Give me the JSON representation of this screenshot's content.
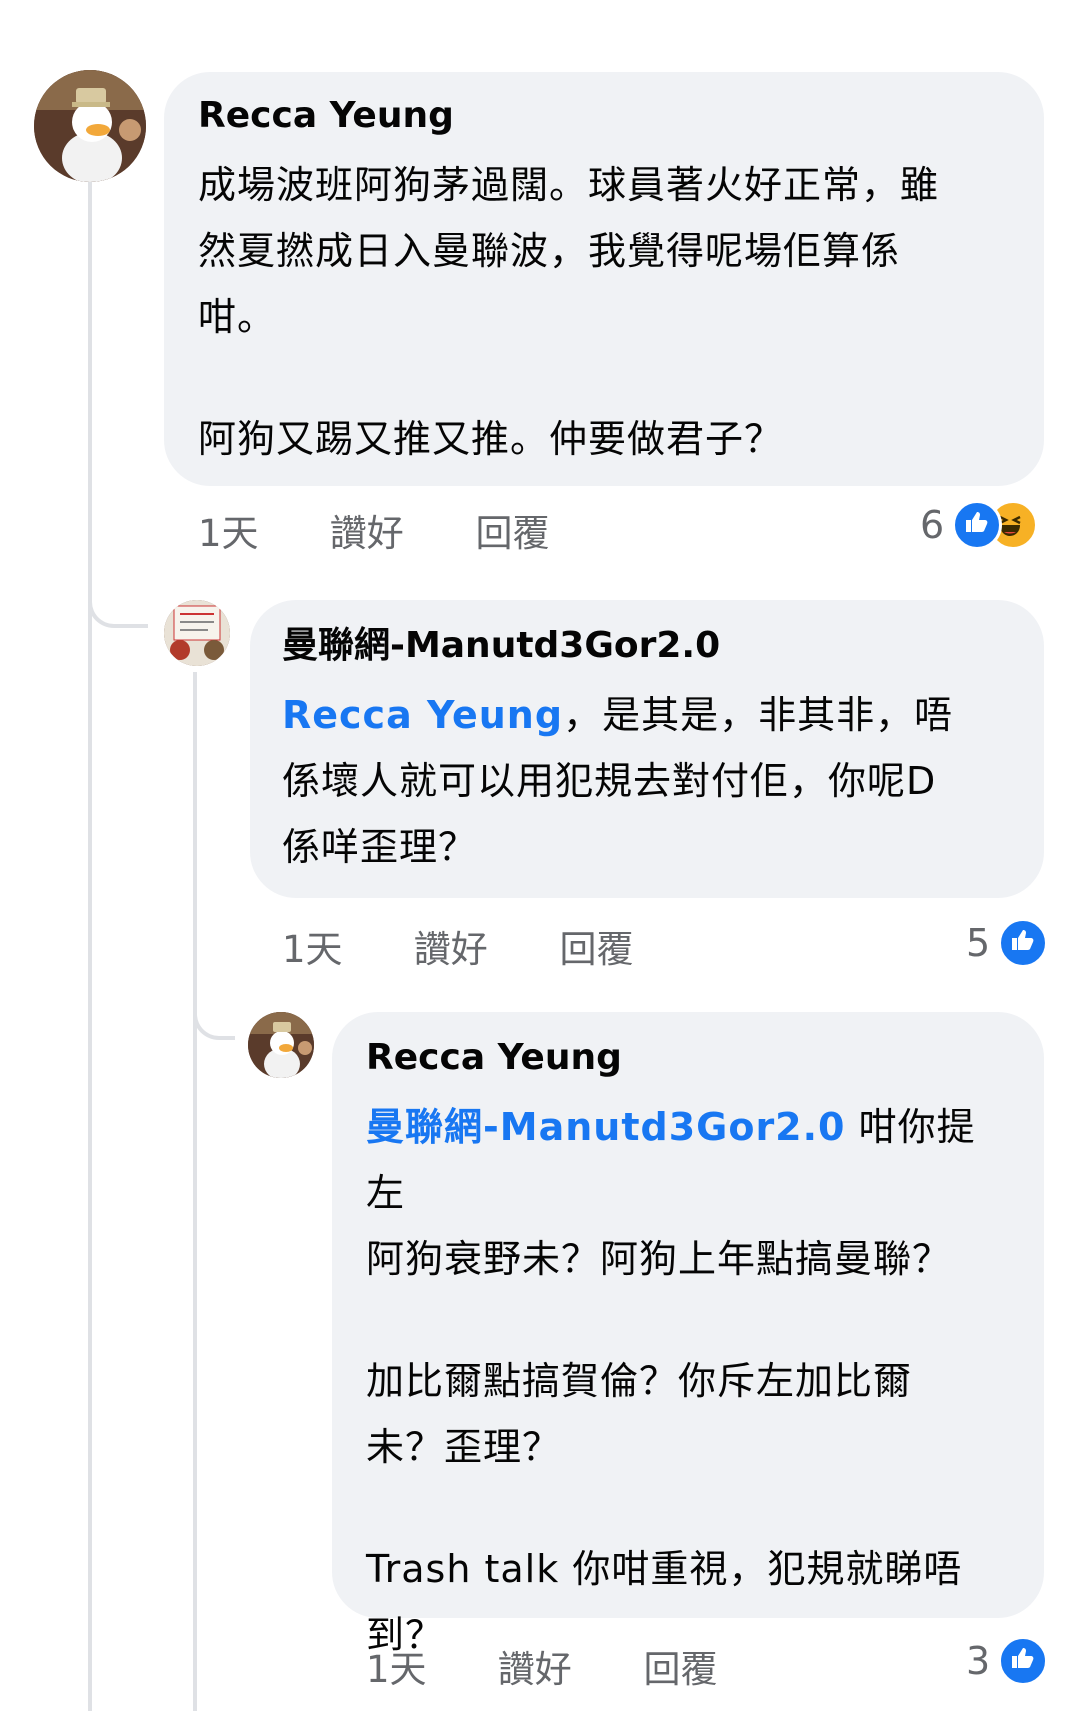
{
  "comments": [
    {
      "author": "Recca Yeung",
      "lines": [
        "成場波班阿狗茅過闊。球員著火好正常，雖",
        "然夏撚成日入曼聯波，我覺得呢場佢算係",
        "咁。"
      ],
      "lines2": [
        "阿狗又踢又推又推。仲要做君子？"
      ],
      "time": "1天",
      "like_label": "讚好",
      "reply_label": "回覆",
      "reaction_count": "6",
      "reactions": [
        "like-icon",
        "haha-icon"
      ]
    },
    {
      "author": "曼聯網-Manutd3Gor2.0",
      "mention": "Recca Yeung",
      "line1_rest": "，是其是，非其非，唔",
      "lines": [
        "係壞人就可以用犯規去對付佢，你呢D",
        "係咩歪理？"
      ],
      "time": "1天",
      "like_label": "讚好",
      "reply_label": "回覆",
      "reaction_count": "5",
      "reactions": [
        "like-icon"
      ]
    },
    {
      "author": "Recca Yeung",
      "mention": "曼聯網-Manutd3Gor2.0",
      "line1_rest": " 咁你提左",
      "lines": [
        "阿狗衰野未？阿狗上年點搞曼聯？"
      ],
      "lines2": [
        "加比爾點搞賀倫？你斥左加比爾",
        "未？歪理？"
      ],
      "lines3": [
        "Trash talk 你咁重視，犯規就睇唔",
        "到？"
      ],
      "time": "1天",
      "like_label": "讚好",
      "reply_label": "回覆",
      "reaction_count": "3",
      "reactions": [
        "like-icon"
      ]
    }
  ],
  "colors": {
    "bubble": "#f0f2f5",
    "mention": "#1877f2",
    "meta": "#65676b",
    "like": "#1877f2",
    "haha": "#f7b125"
  }
}
